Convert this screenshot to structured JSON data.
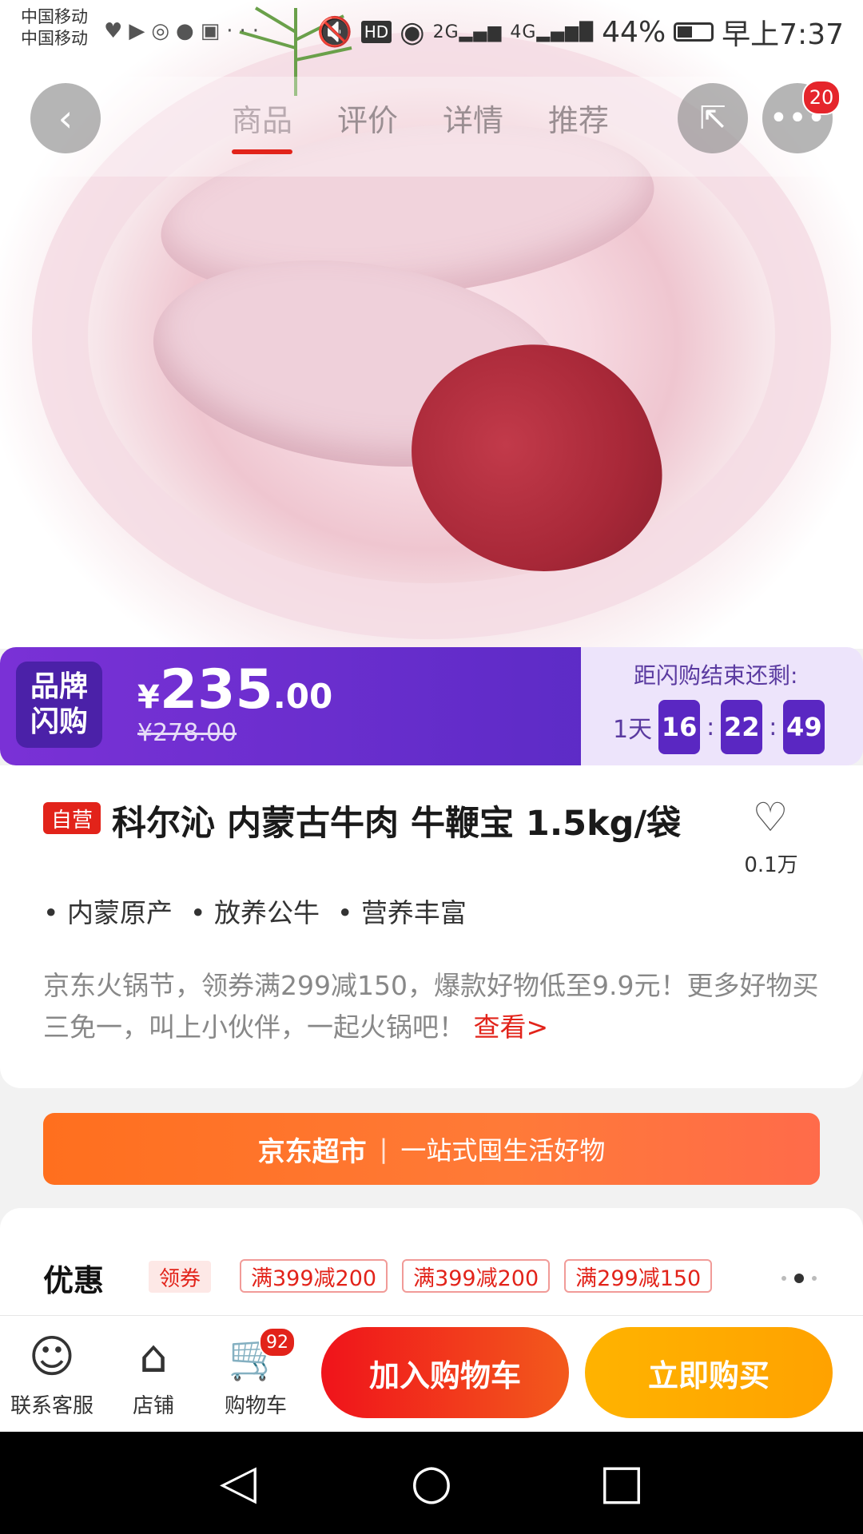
{
  "status_bar": {
    "carrier_1": "中国移动",
    "carrier_2": "中国移动",
    "net_2g": "2G",
    "net_4g": "4G",
    "battery": "44%",
    "time": "早上7:37",
    "icons": [
      "heart-rate-icon",
      "play-icon",
      "wechat-icon",
      "message-icon",
      "app-icon",
      "more-dots-icon",
      "mute-icon",
      "hd-icon",
      "eye-icon"
    ]
  },
  "nav": {
    "tabs": [
      "商品",
      "评价",
      "详情",
      "推荐"
    ],
    "active_tab": "商品",
    "more_badge": "20"
  },
  "flash_sale": {
    "logo_line1": "品牌",
    "logo_line2": "闪购",
    "currency": "¥",
    "price_int": "235",
    "price_dec": ".00",
    "original_price": "¥278.00",
    "countdown_title": "距闪购结束还剩:",
    "days": "1天",
    "hours": "16",
    "minutes": "22",
    "seconds": "49",
    "colon": ":"
  },
  "product": {
    "tag": "自营",
    "title": "科尔沁 内蒙古牛肉 牛鞭宝 1.5kg/袋",
    "favorites": "0.1万",
    "features": [
      "内蒙原产",
      "放养公牛",
      "营养丰富"
    ],
    "promo_text": "京东火锅节，领券满299减150，爆款好物低至9.9元！更多好物买三免一，叫上小伙伴，一起火锅吧！",
    "promo_link": "查看>"
  },
  "supermarket": {
    "brand": "京东超市",
    "separator": "|",
    "slogan": "一站式囤生活好物"
  },
  "coupons": {
    "label": "优惠",
    "get_label": "领券",
    "items": [
      "满399减200",
      "满399减200",
      "满299减150"
    ]
  },
  "actions": {
    "service": "联系客服",
    "store": "店铺",
    "cart": "购物车",
    "cart_badge": "92",
    "add_to_cart": "加入购物车",
    "buy_now": "立即购买"
  },
  "colors": {
    "accent_red": "#e2231a",
    "flash_purple": "#6a2ed0",
    "buy_orange": "#ffa200"
  }
}
